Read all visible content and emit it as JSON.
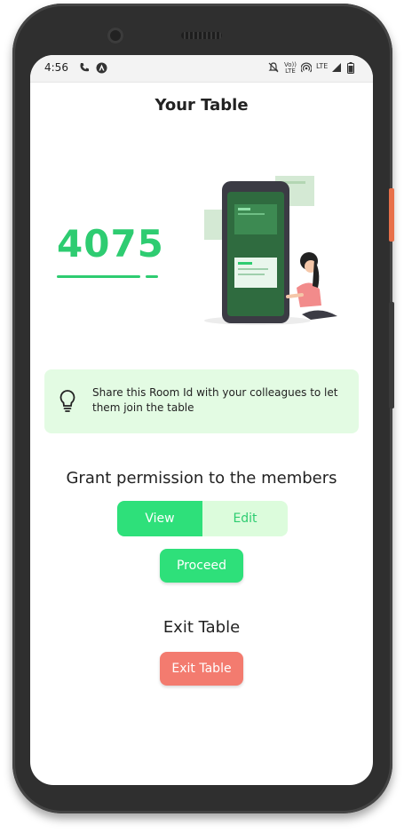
{
  "status_bar": {
    "time": "4:56",
    "icons": [
      "phone-icon",
      "app-icon",
      "mute-icon",
      "volte-icon",
      "hotspot-icon",
      "lte-icon",
      "signal-icon",
      "battery-icon"
    ],
    "volte_label": "Vo)) LTE",
    "lte_label": "LTE"
  },
  "page": {
    "title": "Your Table",
    "room_id": "4075"
  },
  "info_card": {
    "icon": "lightbulb-icon",
    "text": "Share this Room Id with your colleagues to let them join the table"
  },
  "permissions": {
    "title": "Grant permission to the members",
    "options": [
      "View",
      "Edit"
    ],
    "selected": "View",
    "proceed_label": "Proceed"
  },
  "exit": {
    "title": "Exit Table",
    "button_label": "Exit Table"
  },
  "colors": {
    "accent_green": "#2ee07a",
    "light_green": "#dcfcdc",
    "info_bg": "#e3fbe3",
    "exit_red": "#f37b6f"
  }
}
